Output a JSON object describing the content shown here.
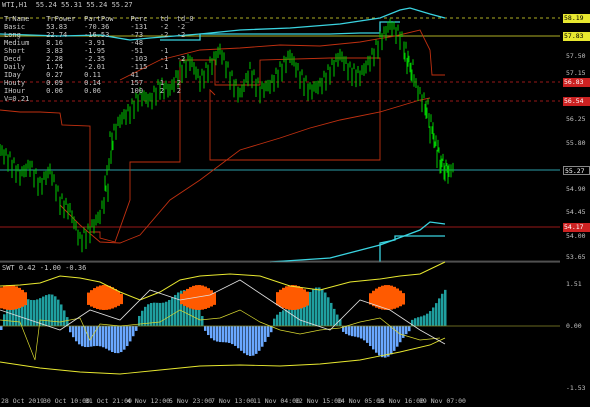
{
  "main_title": "WTI,H1  55.24 55.31 55.24 55.27",
  "sub_title": "SWT 0.42 -1.00 -0.36",
  "info_table": {
    "headers": [
      "TrName",
      "TrPower",
      "PartPow",
      "Perc",
      "td",
      "td_0"
    ],
    "rows": [
      [
        "Basic",
        "53.83",
        "-70.36",
        "-131",
        "-2",
        "-2"
      ],
      [
        "Long",
        "22.74",
        "-16.53",
        "-73",
        "-2",
        "-2"
      ],
      [
        "Medium",
        "8.16",
        "-3.91",
        "-48",
        "",
        ""
      ],
      [
        "Short",
        "3.83",
        "-1.95",
        "-51",
        "-1",
        ""
      ],
      [
        "Decd",
        "2.28",
        "-2.35",
        "-103",
        "-1",
        "-2"
      ],
      [
        "Daily",
        "1.74",
        "-2.01",
        "-115",
        "-1",
        ""
      ],
      [
        "IDay",
        "0.27",
        "0.11",
        "41",
        "",
        ""
      ],
      [
        "Houty",
        "0.09",
        "0.14",
        "157",
        "1",
        "2"
      ],
      [
        "IHour",
        "0.06",
        "0.06",
        "100",
        "2",
        "2"
      ]
    ],
    "footer": "V=0.21"
  },
  "price_axis": [
    "58.19",
    "57.83",
    "57.50",
    "57.15",
    "56.83",
    "56.54",
    "56.25",
    "55.80",
    "55.27",
    "54.90",
    "54.45",
    "54.17",
    "54.00",
    "53.65"
  ],
  "price_tags": [
    {
      "text": "58.19",
      "color": "#e8e830",
      "fg": "#000000"
    },
    {
      "text": "57.83",
      "color": "#e8e830",
      "fg": "#000000"
    },
    {
      "text": "56.83",
      "color": "#cc2222",
      "fg": "#ffffff"
    },
    {
      "text": "56.54",
      "color": "#cc2222",
      "fg": "#ffffff"
    },
    {
      "text": "55.27",
      "color": "#000000",
      "fg": "#ffffff"
    },
    {
      "text": "54.17",
      "color": "#cc2222",
      "fg": "#ffffff"
    }
  ],
  "osc_axis": [
    "1.51",
    "0.00",
    "-1.53"
  ],
  "time_axis": [
    "28 Oct 2019",
    "30 Oct 10:00",
    "31 Oct 21:00",
    "4 Nov 12:00",
    "5 Nov 23:00",
    "7 Nov 13:00",
    "11 Nov 04:00",
    "12 Nov 15:00",
    "14 Nov 05:00",
    "15 Nov 16:00",
    "19 Nov 07:00"
  ],
  "colors": {
    "candle": "#00cc00",
    "cyan": "#3ad3e0",
    "red": "#c03010",
    "yellow": "#e8e830",
    "orange": "#ff5a00",
    "teal": "#1f9f9f",
    "blue": "#6aa8ff"
  }
}
